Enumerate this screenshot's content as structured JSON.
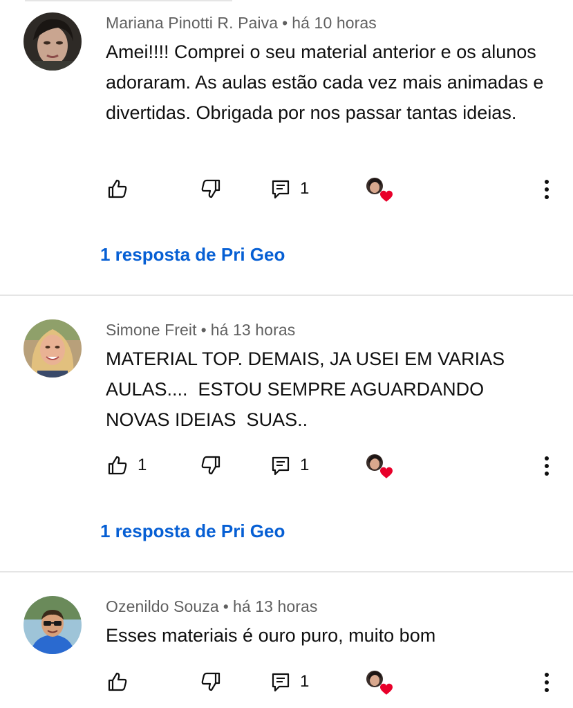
{
  "comments": [
    {
      "author": "Mariana Pinotti R. Paiva",
      "time": "há 10 horas",
      "text": "Amei!!!! Comprei o seu material anterior e os alunos adoraram. As aulas estão cada vez mais animadas e divertidas. Obrigada por nos passar tantas ideias.",
      "like_count": "",
      "reply_count": "1",
      "replies_link": "1 resposta de Pri Geo"
    },
    {
      "author": "Simone Freit",
      "time": "há 13 horas",
      "text": "MATERIAL TOP. DEMAIS, JA USEI EM VARIAS AULAS....  ESTOU SEMPRE AGUARDANDO NOVAS IDEIAS  SUAS..",
      "like_count": "1",
      "reply_count": "1",
      "replies_link": "1 resposta de Pri Geo"
    },
    {
      "author": "Ozenildo Souza",
      "time": "há 13 horas",
      "text": "Esses materiais é ouro puro, muito bom",
      "like_count": "",
      "reply_count": "1",
      "replies_link": ""
    }
  ],
  "separator": "•",
  "colors": {
    "link": "#065fd4",
    "meta": "#606060",
    "heart": "#e8002a",
    "divider": "#e5e5e5"
  },
  "icons": [
    "like-icon",
    "dislike-icon",
    "reply-icon",
    "creator-heart-icon",
    "more-options-icon"
  ]
}
